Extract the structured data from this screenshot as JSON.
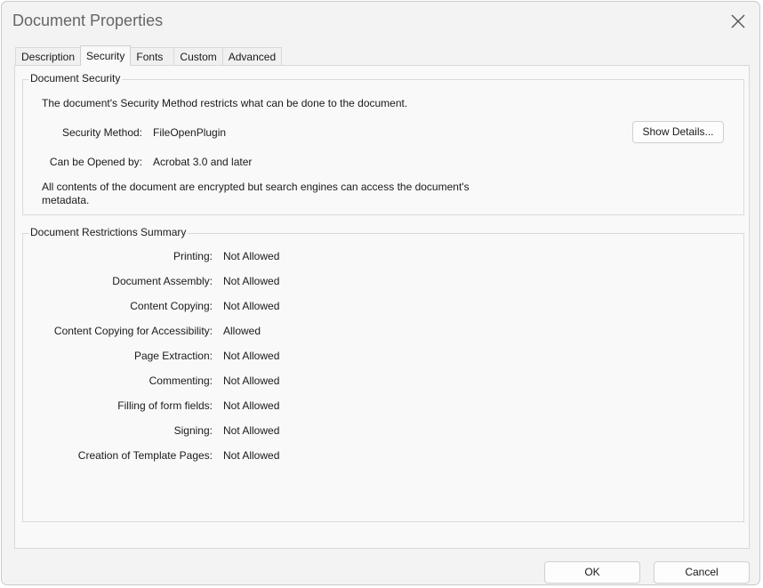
{
  "window": {
    "title": "Document Properties"
  },
  "tabs": [
    {
      "label": "Description"
    },
    {
      "label": "Security"
    },
    {
      "label": "Fonts"
    },
    {
      "label": "Custom"
    },
    {
      "label": "Advanced"
    }
  ],
  "security": {
    "group_title": "Document Security",
    "intro": "The document's Security Method restricts what can be done to the document.",
    "method_label": "Security Method:",
    "method_value": "FileOpenPlugin",
    "opened_by_label": "Can be Opened by:",
    "opened_by_value": "Acrobat 3.0 and later",
    "show_details_label": "Show Details...",
    "encryption_note_line1": "All contents of the document are encrypted but search engines can access the document's",
    "encryption_note_line2": "metadata."
  },
  "restrictions": {
    "group_title": "Document Restrictions Summary",
    "items": [
      {
        "label": "Printing:",
        "value": "Not Allowed"
      },
      {
        "label": "Document Assembly:",
        "value": "Not Allowed"
      },
      {
        "label": "Content Copying:",
        "value": "Not Allowed"
      },
      {
        "label": "Content Copying for Accessibility:",
        "value": "Allowed"
      },
      {
        "label": "Page Extraction:",
        "value": "Not Allowed"
      },
      {
        "label": "Commenting:",
        "value": "Not Allowed"
      },
      {
        "label": "Filling of form fields:",
        "value": "Not Allowed"
      },
      {
        "label": "Signing:",
        "value": "Not Allowed"
      },
      {
        "label": "Creation of Template Pages:",
        "value": "Not Allowed"
      }
    ]
  },
  "footer": {
    "ok_label": "OK",
    "cancel_label": "Cancel"
  }
}
